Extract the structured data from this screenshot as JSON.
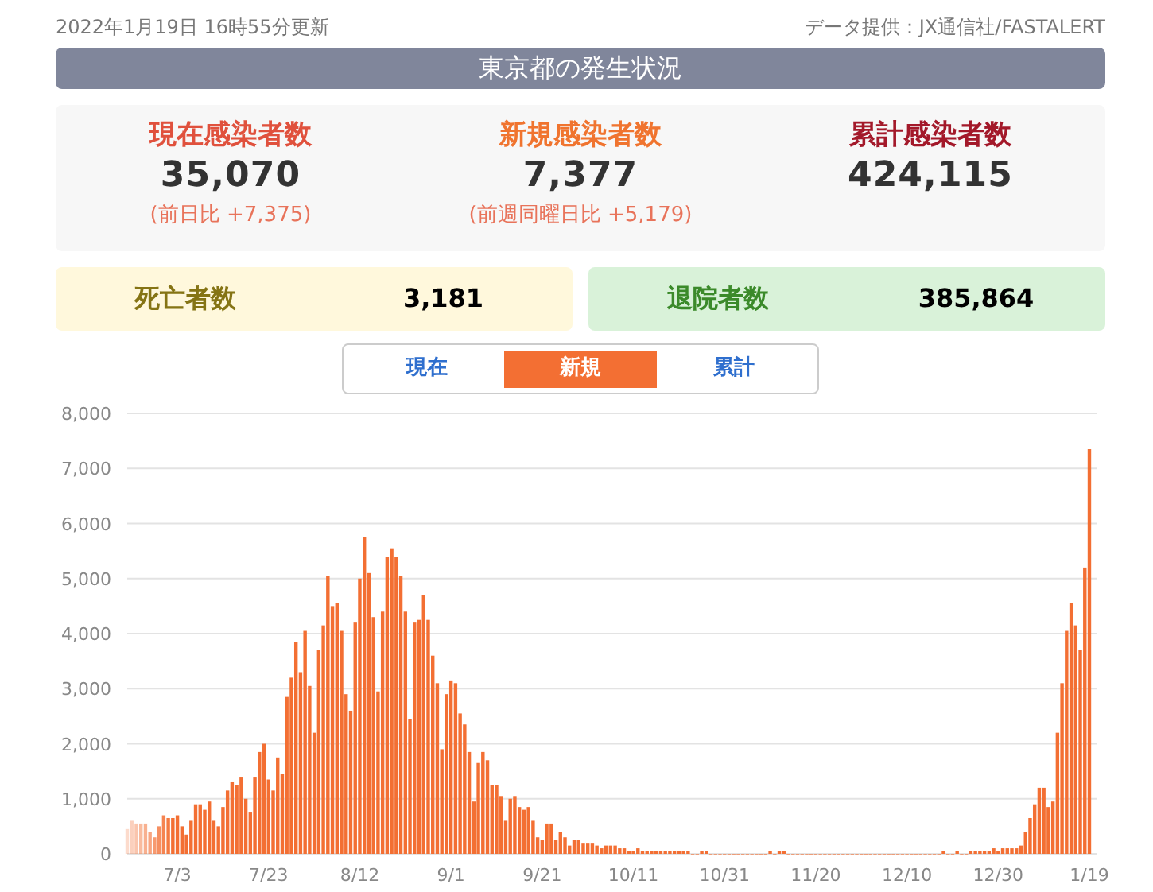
{
  "updated": "2022年1月19日 16時55分更新",
  "source": "データ提供：JX通信社/FASTALERT",
  "title": "東京都の発生状況",
  "stats": [
    {
      "label": "現在感染者数",
      "value": "35,070",
      "change": "(前日比 +7,375)",
      "color": "#e0513d"
    },
    {
      "label": "新規感染者数",
      "value": "7,377",
      "change": "(前週同曜日比 +5,179)",
      "color": "#f0742f"
    },
    {
      "label": "累計感染者数",
      "value": "424,115",
      "color": "#a3192a"
    }
  ],
  "totals": [
    {
      "label": "死亡者数",
      "value": "3,181",
      "kind": "deaths"
    },
    {
      "label": "退院者数",
      "value": "385,864",
      "kind": "recovered"
    }
  ],
  "tabs": [
    {
      "label": "現在",
      "selected": false
    },
    {
      "label": "新規",
      "selected": true
    },
    {
      "label": "累計",
      "selected": false
    }
  ],
  "chart": {
    "chart_data": {
      "type": "bar",
      "grid": true,
      "categories": [
        null,
        null,
        null,
        null,
        null,
        null,
        null,
        null,
        null,
        null,
        null,
        "7/3",
        null,
        null,
        null,
        null,
        null,
        null,
        null,
        null,
        null,
        null,
        null,
        null,
        null,
        null,
        null,
        null,
        null,
        null,
        null,
        "7/23",
        null,
        null,
        null,
        null,
        null,
        null,
        null,
        null,
        null,
        null,
        null,
        null,
        null,
        null,
        null,
        null,
        null,
        null,
        null,
        "8/12",
        null,
        null,
        null,
        null,
        null,
        null,
        null,
        null,
        null,
        null,
        null,
        null,
        null,
        null,
        null,
        null,
        null,
        null,
        null,
        "9/1",
        null,
        null,
        null,
        null,
        null,
        null,
        null,
        null,
        null,
        null,
        null,
        null,
        null,
        null,
        null,
        null,
        null,
        null,
        null,
        "9/21",
        null,
        null,
        null,
        null,
        null,
        null,
        null,
        null,
        null,
        null,
        null,
        null,
        null,
        null,
        null,
        null,
        null,
        null,
        null,
        "10/11",
        null,
        null,
        null,
        null,
        null,
        null,
        null,
        null,
        null,
        null,
        null,
        null,
        null,
        null,
        null,
        null,
        null,
        null,
        null,
        "10/31",
        null,
        null,
        null,
        null,
        null,
        null,
        null,
        null,
        null,
        null,
        null,
        null,
        null,
        null,
        null,
        null,
        null,
        null,
        null,
        "11/20",
        null,
        null,
        null,
        null,
        null,
        null,
        null,
        null,
        null,
        null,
        null,
        null,
        null,
        null,
        null,
        null,
        null,
        null,
        null,
        "12/10",
        null,
        null,
        null,
        null,
        null,
        null,
        null,
        null,
        null,
        null,
        null,
        null,
        null,
        null,
        null,
        null,
        null,
        null,
        null,
        "12/30",
        null,
        null,
        null,
        null,
        null,
        null,
        null,
        null,
        null,
        null,
        null,
        null,
        null,
        null,
        null,
        null,
        null,
        null,
        null,
        "1/19"
      ],
      "series": [
        {
          "color": "#f36f33",
          "values": [
            450,
            600,
            550,
            550,
            550,
            400,
            300,
            500,
            700,
            650,
            650,
            700,
            500,
            350,
            600,
            900,
            900,
            800,
            950,
            600,
            500,
            850,
            1150,
            1300,
            1250,
            1400,
            1000,
            750,
            1400,
            1850,
            2000,
            1350,
            1150,
            1750,
            1450,
            2850,
            3200,
            3850,
            3300,
            4050,
            3050,
            2200,
            3700,
            4150,
            5050,
            4500,
            4550,
            4050,
            2900,
            2600,
            4200,
            5000,
            5750,
            5100,
            4300,
            2950,
            4400,
            5400,
            5550,
            5400,
            5050,
            4400,
            2450,
            4200,
            4250,
            4700,
            4250,
            3600,
            3100,
            1900,
            2900,
            3150,
            3100,
            2550,
            2350,
            1850,
            950,
            1650,
            1850,
            1700,
            1250,
            1250,
            1050,
            600,
            1000,
            1050,
            850,
            800,
            850,
            600,
            300,
            250,
            550,
            550,
            250,
            400,
            300,
            150,
            250,
            250,
            200,
            200,
            200,
            150,
            100,
            150,
            150,
            150,
            100,
            100,
            50,
            50,
            100,
            50,
            50,
            50,
            50,
            50,
            50,
            50,
            50,
            50,
            50,
            50,
            0,
            0,
            50,
            50,
            0,
            0,
            0,
            0,
            0,
            0,
            0,
            0,
            0,
            0,
            0,
            0,
            0,
            50,
            0,
            50,
            50,
            0,
            0,
            0,
            0,
            0,
            0,
            0,
            0,
            0,
            0,
            0,
            0,
            0,
            0,
            0,
            0,
            0,
            0,
            0,
            0,
            0,
            0,
            0,
            0,
            0,
            0,
            0,
            0,
            0,
            0,
            0,
            0,
            0,
            0,
            50,
            0,
            0,
            50,
            0,
            0,
            50,
            50,
            50,
            50,
            50,
            100,
            50,
            100,
            100,
            100,
            100,
            150,
            400,
            650,
            900,
            1200,
            1200,
            850,
            950,
            2200,
            3100,
            4050,
            4550,
            4150,
            3700,
            5200,
            7350
          ]
        }
      ],
      "ylim": [
        0,
        8000
      ],
      "yticks": [
        {
          "value": 0,
          "label": "0"
        },
        {
          "value": 1000,
          "label": "1,000"
        },
        {
          "value": 2000,
          "label": "2,000"
        },
        {
          "value": 3000,
          "label": "3,000"
        },
        {
          "value": 4000,
          "label": "4,000"
        },
        {
          "value": 5000,
          "label": "5,000"
        },
        {
          "value": 6000,
          "label": "6,000"
        },
        {
          "value": 7000,
          "label": "7,000"
        },
        {
          "value": 8000,
          "label": "8,000"
        }
      ]
    }
  }
}
